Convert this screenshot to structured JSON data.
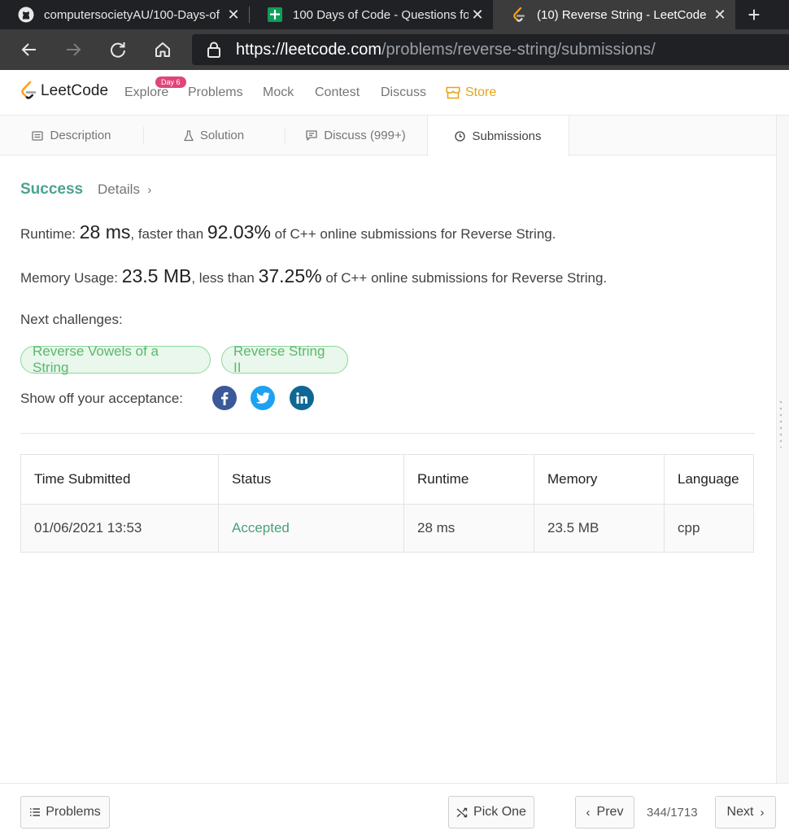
{
  "browser": {
    "tabs": [
      {
        "title": "computersocietyAU/100-Days-of",
        "icon": "github-icon"
      },
      {
        "title": "100 Days of Code - Questions fo",
        "icon": "google-sheets-icon"
      },
      {
        "title": "(10) Reverse String - LeetCode",
        "icon": "leetcode-icon",
        "active": true
      }
    ],
    "url_scheme": "https://",
    "url_host": "leetcode.com",
    "url_path": "/problems/reverse-string/submissions/"
  },
  "nav": {
    "logo": "LeetCode",
    "explore": "Explore",
    "explore_badge": "Day 6",
    "problems": "Problems",
    "mock": "Mock",
    "contest": "Contest",
    "discuss": "Discuss",
    "store": "Store"
  },
  "problem_tabs": {
    "description": "Description",
    "solution": "Solution",
    "discuss": "Discuss (999+)",
    "submissions": "Submissions"
  },
  "result": {
    "status": "Success",
    "details": "Details",
    "runtime_label": "Runtime: ",
    "runtime_value": "28 ms",
    "runtime_mid": ", faster than ",
    "runtime_pct": "92.03%",
    "runtime_tail": " of C++ online submissions for Reverse String.",
    "memory_label": "Memory Usage: ",
    "memory_value": "23.5 MB",
    "memory_mid": ", less than ",
    "memory_pct": "37.25%",
    "memory_tail": " of C++ online submissions for Reverse String.",
    "next_label": "Next challenges:",
    "challenges": [
      "Reverse Vowels of a String",
      "Reverse String II"
    ],
    "share_label": "Show off your acceptance:"
  },
  "table": {
    "headers": [
      "Time Submitted",
      "Status",
      "Runtime",
      "Memory",
      "Language"
    ],
    "rows": [
      {
        "time": "01/06/2021 13:53",
        "status": "Accepted",
        "runtime": "28 ms",
        "memory": "23.5 MB",
        "language": "cpp"
      }
    ]
  },
  "footer": {
    "problems": "Problems",
    "pick_one": "Pick One",
    "prev": "Prev",
    "page": "344/1713",
    "next": "Next"
  },
  "colors": {
    "success": "#4aa38f",
    "accepted": "#4aa07a",
    "store": "#e8a317",
    "badge": "#e0457b",
    "facebook": "#3b5998",
    "twitter": "#1da1f2",
    "linkedin": "#0e6795"
  }
}
